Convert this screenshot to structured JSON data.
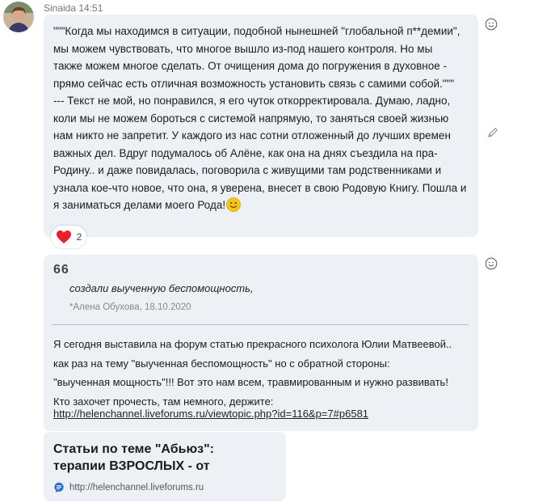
{
  "header": {
    "sender_name": "Sinaida",
    "time": "14:51"
  },
  "message1": {
    "text": "\"\"\"Когда мы находимся в ситуации, подобной нынешней \"глобальной п**демии\",\nмы можем чувствовать, что многое вышло из-под нашего контроля.  Но мы\nтакже можем многое сделать. От очищения дома до погружения в духовное -\nпрямо сейчас есть отличная возможность установить связь с самими собой.\"\"\"\n --- Текст не мой, но понравился, я его чуток откорректировала. Думаю, ладно,\nколи мы не можем бороться с системой напрямую, то заняться своей жизнью\nнам никто не запретит. У каждого из нас сотни отложенный до лучших времен\nважных дел. Вдруг подумалось об Алёне, как она на днях съездила на пра-\nРодину.. и даже повидалась, поговорила с живущими там родственниками и\nузнала кое-что новое, что она, я уверена, внесет в свою Родовую Книгу. Пошла и\nя заниматься делами моего Рода!",
    "reaction_count": "2"
  },
  "message2": {
    "quote_symbol": "66",
    "quote_text": "создали выученную беспомощность,",
    "quote_meta": "*Алена Обухова, 18.10.2020",
    "text": "Я сегодня выставила на форум статью прекрасного психолога Юлии Матвеевой..\nкак раз на тему  \"выученная беспомощность\" но с обратной стороны:\n\"выученная мощность\"!!! Вот это нам всем, травмированным и нужно развивать!\nКто захочет прочесть, там немного, держите:",
    "link": "http://helenchannel.liveforums.ru/viewtopic.php?id=116&p=7#p6581"
  },
  "link_preview": {
    "title": "Статьи по теме \"Абьюз\":\nтерапии ВЗРОСЛЫХ - от",
    "url": "http://helenchannel.liveforums.ru"
  },
  "icons": {
    "reaction": "heart-icon",
    "add_reaction": "smiley-icon",
    "edit": "pencil-icon",
    "inline_emoji": "smile-emoji-icon",
    "site": "speech-bubble-icon"
  },
  "colors": {
    "bubble": "#edf1f6",
    "heart": "#e8202a",
    "emoji": "#f5c518",
    "site_icon": "#2b6fc4"
  }
}
